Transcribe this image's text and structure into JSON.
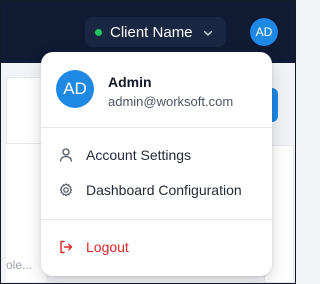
{
  "header": {
    "client_selector": {
      "label": "Client Name",
      "status_color": "#22c55e",
      "icon": "chevron-down-icon"
    },
    "user_avatar_initials": "AD"
  },
  "background": {
    "input_placeholder_fragment": "ole..."
  },
  "user_menu": {
    "avatar_initials": "AD",
    "user_name": "Admin",
    "user_email": "admin@worksoft.com",
    "items": [
      {
        "label": "Account Settings",
        "icon": "user-icon"
      },
      {
        "label": "Dashboard Configuration",
        "icon": "gear-icon"
      }
    ],
    "logout": {
      "label": "Logout",
      "icon": "logout-icon",
      "color": "#dc2626"
    }
  },
  "colors": {
    "topbar": "#101a33",
    "accent": "#1e88e5",
    "danger": "#dc2626"
  }
}
